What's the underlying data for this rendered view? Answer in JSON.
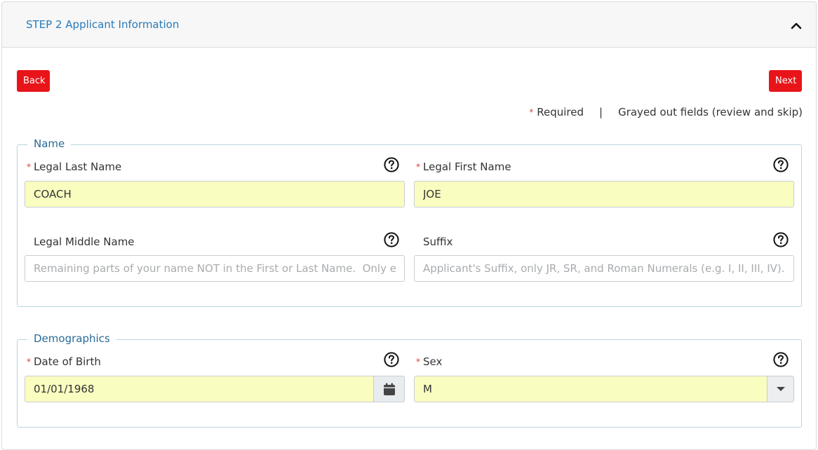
{
  "header": {
    "title": "STEP 2 Applicant Information",
    "toggle_icon": "chevron-up-icon"
  },
  "actions": {
    "back_label": "Back",
    "next_label": "Next"
  },
  "legend": {
    "required_star": "*",
    "required_label": "Required",
    "separator": "|",
    "grayed_label": "Grayed out fields (review and skip)"
  },
  "name_section": {
    "legend": "Name",
    "last_name": {
      "label": "Legal Last Name",
      "value": "COACH",
      "required": true
    },
    "first_name": {
      "label": "Legal First Name",
      "value": "JOE",
      "required": true
    },
    "middle_name": {
      "label": "Legal Middle Name",
      "value": "",
      "placeholder": "Remaining parts of your name NOT in the First or Last Name.  Only enter"
    },
    "suffix": {
      "label": "Suffix",
      "value": "",
      "placeholder": "Applicant's Suffix, only JR, SR, and Roman Numerals (e.g. I, II, III, IV)."
    }
  },
  "demographics_section": {
    "legend": "Demographics",
    "dob": {
      "label": "Date of Birth",
      "value": "01/01/1968",
      "required": true
    },
    "sex": {
      "label": "Sex",
      "value": "M",
      "required": true
    }
  },
  "colors": {
    "accent": "#2a7ab8",
    "button": "#e8141a",
    "required": "#e03b3b",
    "filled_bg": "#fafdc0"
  }
}
